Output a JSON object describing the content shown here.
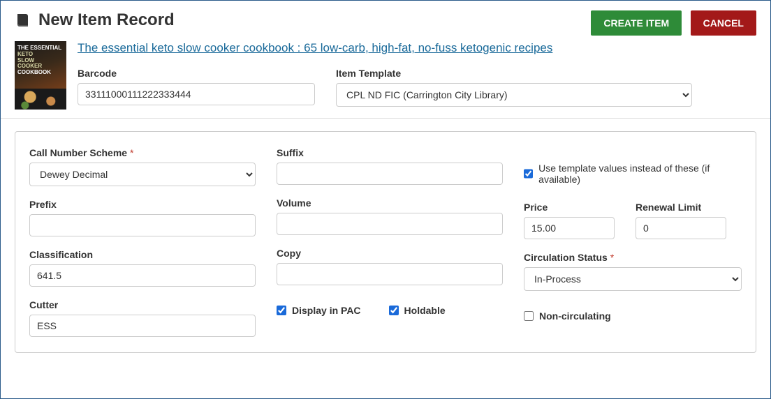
{
  "header": {
    "title": "New Item Record",
    "create_label": "CREATE ITEM",
    "cancel_label": "CANCEL"
  },
  "book": {
    "title_link": "The essential keto slow cooker cookbook : 65 low-carb, high-fat, no-fuss ketogenic recipes",
    "cover_text_line1": "THE ESSENTIAL",
    "cover_text_line2": "KETO",
    "cover_text_line3": "SLOW",
    "cover_text_line4": "COOKER",
    "cover_text_line5": "COOKBOOK"
  },
  "topfields": {
    "barcode_label": "Barcode",
    "barcode_value": "33111000111222333444",
    "template_label": "Item Template",
    "template_value": "CPL ND FIC (Carrington City Library)"
  },
  "form": {
    "call_scheme_label": "Call Number Scheme",
    "call_scheme_value": "Dewey Decimal",
    "prefix_label": "Prefix",
    "prefix_value": "",
    "classification_label": "Classification",
    "classification_value": "641.5",
    "cutter_label": "Cutter",
    "cutter_value": "ESS",
    "suffix_label": "Suffix",
    "suffix_value": "",
    "volume_label": "Volume",
    "volume_value": "",
    "copy_label": "Copy",
    "copy_value": "",
    "display_pac_label": "Display in PAC",
    "display_pac_checked": true,
    "holdable_label": "Holdable",
    "holdable_checked": true,
    "use_template_label": "Use template values instead of these (if available)",
    "use_template_checked": true,
    "price_label": "Price",
    "price_value": "15.00",
    "renewal_label": "Renewal Limit",
    "renewal_value": "0",
    "circ_status_label": "Circulation Status",
    "circ_status_value": "In-Process",
    "noncirc_label": "Non-circulating",
    "noncirc_checked": false
  }
}
